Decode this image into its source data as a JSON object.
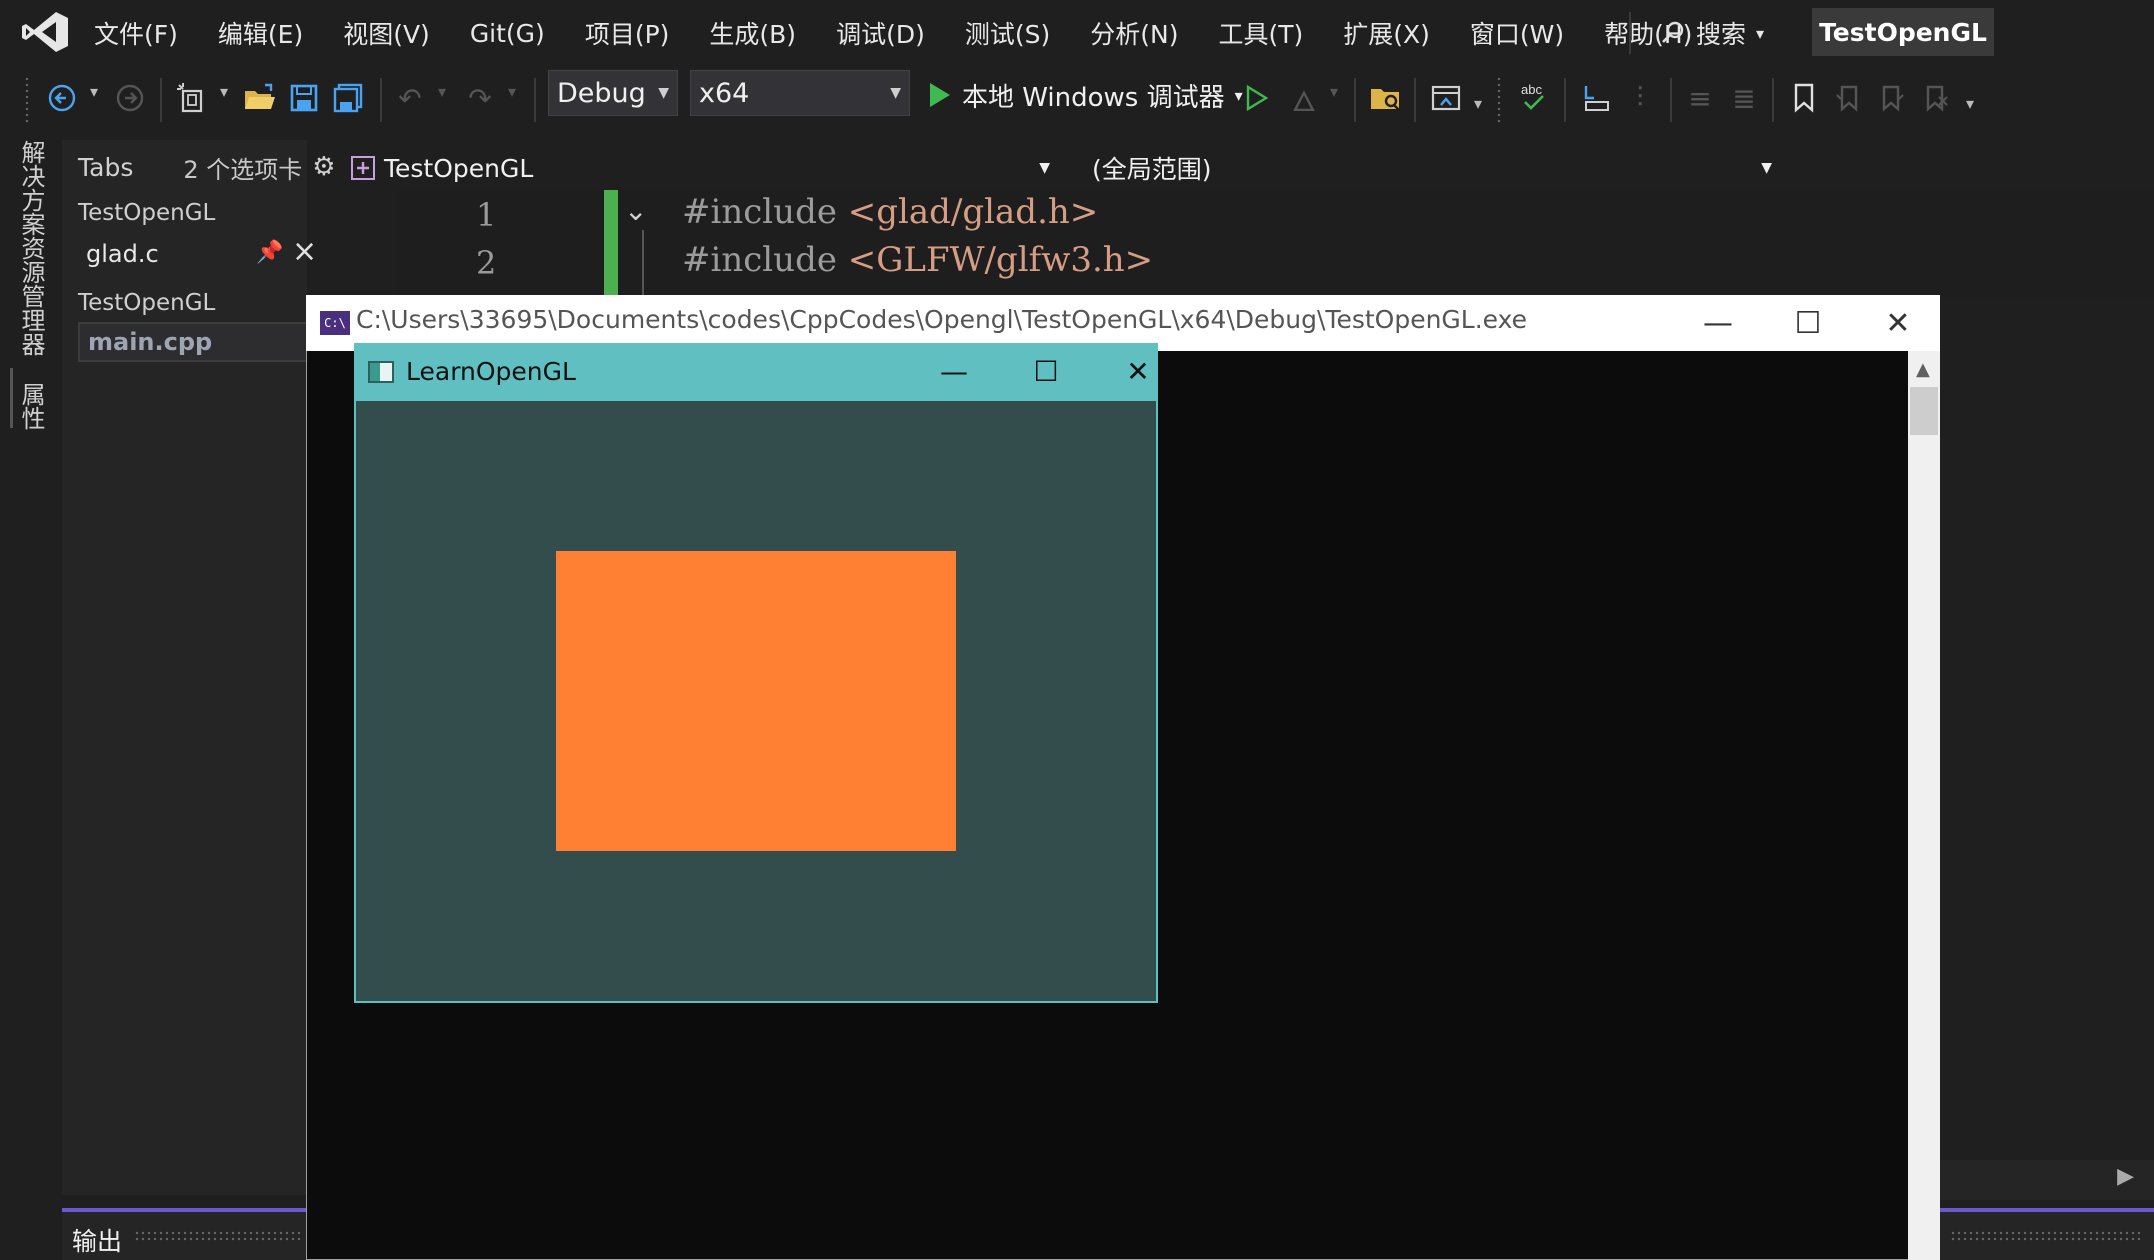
{
  "menubar": {
    "items": [
      "文件(F)",
      "编辑(E)",
      "视图(V)",
      "Git(G)",
      "项目(P)",
      "生成(B)",
      "调试(D)",
      "测试(S)",
      "分析(N)",
      "工具(T)",
      "扩展(X)",
      "窗口(W)",
      "帮助(H)"
    ],
    "search_label": "搜索",
    "project_name": "TestOpenGL"
  },
  "toolbar": {
    "configuration": "Debug",
    "platform": "x64",
    "debugger_label": "本地 Windows 调试器"
  },
  "side_tabs": {
    "solution_explorer": "解决方案资源管理器",
    "properties": "属性"
  },
  "tabs_panel": {
    "title": "Tabs",
    "count": "2 个选项卡",
    "groups": [
      {
        "project": "TestOpenGL",
        "file": "glad.c"
      },
      {
        "project": "TestOpenGL",
        "file": "main.cpp"
      }
    ]
  },
  "editor": {
    "project_combo": "TestOpenGL",
    "scope_combo": "(全局范围)",
    "lines": [
      {
        "number": "1",
        "keyword": "#include",
        "target": "<glad/glad.h>"
      },
      {
        "number": "2",
        "keyword": "#include",
        "target": "<GLFW/glfw3.h>"
      }
    ]
  },
  "console": {
    "title": "C:\\Users\\33695\\Documents\\codes\\CppCodes\\Opengl\\TestOpenGL\\x64\\Debug\\TestOpenGL.exe",
    "icon_text": "C:\\"
  },
  "glwindow": {
    "title": "LearnOpenGL",
    "background_color": "#334d4d",
    "rect_color": "#ff7f33"
  },
  "output": {
    "label": "输出"
  },
  "colors": {
    "accent_purple": "#6a5acd",
    "change_green": "#4caf50",
    "play_green": "#3fb950"
  }
}
